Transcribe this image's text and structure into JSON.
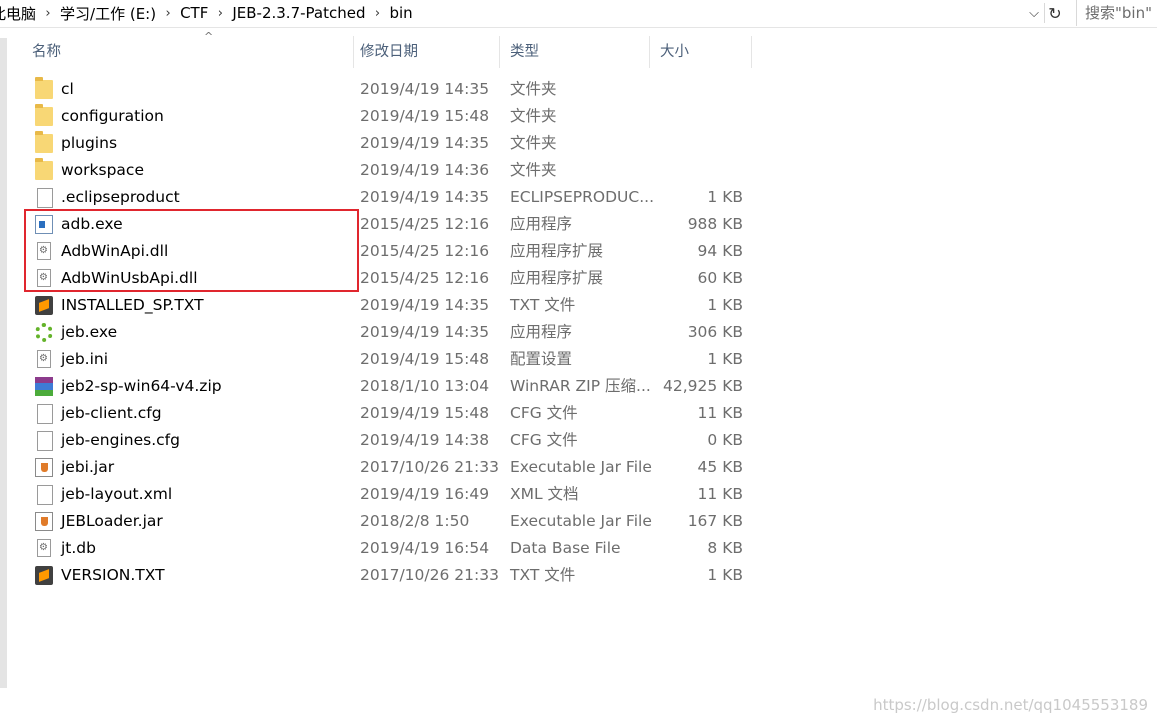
{
  "breadcrumb": [
    "此电脑",
    "学习/工作 (E:)",
    "CTF",
    "JEB-2.3.7-Patched",
    "bin"
  ],
  "search": {
    "placeholder": "搜索\"bin\""
  },
  "columns": {
    "name": "名称",
    "modified": "修改日期",
    "type": "类型",
    "size": "大小"
  },
  "files": [
    {
      "name": "cl",
      "modified": "2019/4/19 14:35",
      "type": "文件夹",
      "size": "",
      "icon": "folder-icon"
    },
    {
      "name": "configuration",
      "modified": "2019/4/19 15:48",
      "type": "文件夹",
      "size": "",
      "icon": "folder-icon"
    },
    {
      "name": "plugins",
      "modified": "2019/4/19 14:35",
      "type": "文件夹",
      "size": "",
      "icon": "folder-icon"
    },
    {
      "name": "workspace",
      "modified": "2019/4/19 14:36",
      "type": "文件夹",
      "size": "",
      "icon": "folder-icon"
    },
    {
      "name": ".eclipseproduct",
      "modified": "2019/4/19 14:35",
      "type": "ECLIPSEPRODUC...",
      "size": "1 KB",
      "icon": "blank-file-icon"
    },
    {
      "name": "adb.exe",
      "modified": "2015/4/25 12:16",
      "type": "应用程序",
      "size": "988 KB",
      "icon": "exe-icon"
    },
    {
      "name": "AdbWinApi.dll",
      "modified": "2015/4/25 12:16",
      "type": "应用程序扩展",
      "size": "94 KB",
      "icon": "dll-icon"
    },
    {
      "name": "AdbWinUsbApi.dll",
      "modified": "2015/4/25 12:16",
      "type": "应用程序扩展",
      "size": "60 KB",
      "icon": "dll-icon"
    },
    {
      "name": "INSTALLED_SP.TXT",
      "modified": "2019/4/19 14:35",
      "type": "TXT 文件",
      "size": "1 KB",
      "icon": "sublime-text-icon"
    },
    {
      "name": "jeb.exe",
      "modified": "2019/4/19 14:35",
      "type": "应用程序",
      "size": "306 KB",
      "icon": "jeb-icon"
    },
    {
      "name": "jeb.ini",
      "modified": "2019/4/19 15:48",
      "type": "配置设置",
      "size": "1 KB",
      "icon": "settings-file-icon"
    },
    {
      "name": "jeb2-sp-win64-v4.zip",
      "modified": "2018/1/10 13:04",
      "type": "WinRAR ZIP 压缩...",
      "size": "42,925 KB",
      "icon": "winrar-icon"
    },
    {
      "name": "jeb-client.cfg",
      "modified": "2019/4/19 15:48",
      "type": "CFG 文件",
      "size": "11 KB",
      "icon": "blank-file-icon"
    },
    {
      "name": "jeb-engines.cfg",
      "modified": "2019/4/19 14:38",
      "type": "CFG 文件",
      "size": "0 KB",
      "icon": "blank-file-icon"
    },
    {
      "name": "jebi.jar",
      "modified": "2017/10/26 21:33",
      "type": "Executable Jar File",
      "size": "45 KB",
      "icon": "java-jar-icon"
    },
    {
      "name": "jeb-layout.xml",
      "modified": "2019/4/19 16:49",
      "type": "XML 文档",
      "size": "11 KB",
      "icon": "blank-file-icon"
    },
    {
      "name": "JEBLoader.jar",
      "modified": "2018/2/8 1:50",
      "type": "Executable Jar File",
      "size": "167 KB",
      "icon": "java-jar-icon"
    },
    {
      "name": "jt.db",
      "modified": "2019/4/19 16:54",
      "type": "Data Base File",
      "size": "8 KB",
      "icon": "dll-icon"
    },
    {
      "name": "VERSION.TXT",
      "modified": "2017/10/26 21:33",
      "type": "TXT 文件",
      "size": "1 KB",
      "icon": "sublime-text-icon"
    }
  ],
  "watermark": "https://blog.csdn.net/qq1045553189",
  "colors": {
    "highlight": "#e0262e",
    "header_text": "#4c607a",
    "secondary_text": "#6d6d6d"
  }
}
